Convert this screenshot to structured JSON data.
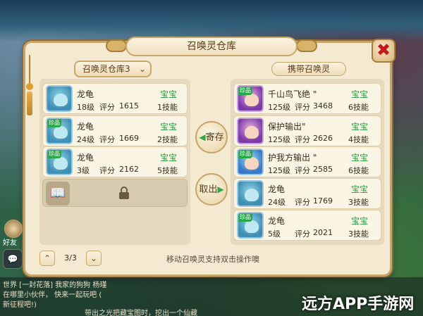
{
  "dialog": {
    "title": "召唤灵仓库",
    "close_glyph": "✖"
  },
  "left_panel": {
    "dropdown_label": "召唤灵仓库3",
    "dropdown_chevron": "⌄",
    "cards": [
      {
        "name": "龙龟",
        "type": "宝宝",
        "level": "18级",
        "score_label": "评分",
        "score": "1615",
        "skills": "1技能",
        "badge": ""
      },
      {
        "name": "龙龟",
        "type": "宝宝",
        "level": "24级",
        "score_label": "评分",
        "score": "1669",
        "skills": "2技能",
        "badge": "珍品"
      },
      {
        "name": "龙龟",
        "type": "宝宝",
        "level": "3级",
        "score_label": "评分",
        "score": "2162",
        "skills": "5技能",
        "badge": "珍品"
      }
    ],
    "empty_slot_icon": "📖",
    "lock_icon": "lock-icon"
  },
  "right_panel": {
    "header": "携带召唤灵",
    "cards": [
      {
        "name": "千山鸟飞绝 \"",
        "type": "宝宝",
        "level": "125级",
        "score_label": "评分",
        "score": "3468",
        "skills": "6技能",
        "badge": "珍品",
        "avatar": "purple"
      },
      {
        "name": "保护输出\"",
        "type": "宝宝",
        "level": "125级",
        "score_label": "评分",
        "score": "2626",
        "skills": "4技能",
        "badge": "",
        "avatar": "purple"
      },
      {
        "name": "护我方输出 \"",
        "type": "宝宝",
        "level": "125级",
        "score_label": "评分",
        "score": "2585",
        "skills": "6技能",
        "badge": "珍品",
        "avatar": "blue"
      },
      {
        "name": "龙龟",
        "type": "宝宝",
        "level": "24级",
        "score_label": "评分",
        "score": "1769",
        "skills": "3技能",
        "badge": "",
        "avatar": "turtle"
      },
      {
        "name": "龙龟",
        "type": "宝宝",
        "level": "5级",
        "score_label": "评分",
        "score": "2021",
        "skills": "3技能",
        "badge": "珍品",
        "avatar": "turtle"
      }
    ]
  },
  "actions": {
    "deposit_label": "寄存",
    "deposit_arrow": "◀",
    "withdraw_label": "取出",
    "withdraw_arrow": "▶"
  },
  "pager": {
    "prev_glyph": "⌃",
    "next_glyph": "⌄",
    "page": "3/3"
  },
  "hint": "移动召唤灵支持双击操作噢",
  "side": {
    "friend_label": "好友",
    "chat_glyph": "💬"
  },
  "chat": {
    "lines": [
      "世界 [一封花落] 我家的狗狗 杨瑾",
      "在哪里小伙伴，     快来一起玩吧 (",
      "新征程吧!)",
      "        带出之光把藏宝图时，挖出一个仙藏"
    ]
  },
  "watermark": "远方APP手游网"
}
